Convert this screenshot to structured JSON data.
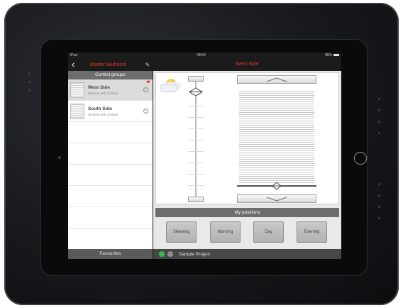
{
  "status_bar": {
    "left": "iPad",
    "time": "08:54",
    "battery": "85%"
  },
  "left_panel": {
    "title": "Master Bedroom",
    "section_header": "Control groups",
    "groups": [
      {
        "name": "West Side",
        "description": "Window with 3 blinds",
        "selected": true,
        "favourite": true
      },
      {
        "name": "South Side",
        "description": "Window with 2 blinds",
        "selected": false,
        "favourite": false
      }
    ],
    "footer": "Favourites"
  },
  "right_panel": {
    "title": "West Side",
    "positions_header": "My positions",
    "positions": [
      "Sleeping",
      "Morning",
      "Day",
      "Evening"
    ],
    "project": "Sample Project",
    "status_colors": {
      "online": "#3cb84a",
      "offline": "#8c8c8c"
    }
  },
  "icons": {
    "back": "chevron-left-icon",
    "edit": "pencil-icon",
    "favourite": "heart-icon",
    "weather": "sun-cloud-icon"
  },
  "colors": {
    "accent": "#e0352f"
  }
}
